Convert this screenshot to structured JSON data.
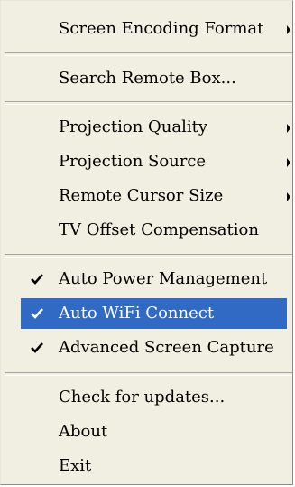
{
  "menu": {
    "items": [
      {
        "label": "Screen Encoding Format",
        "submenu": true
      },
      {
        "label": "Search Remote Box...",
        "submenu": false
      },
      {
        "label": "Projection Quality",
        "submenu": true
      },
      {
        "label": "Projection Source",
        "submenu": true
      },
      {
        "label": "Remote Cursor Size",
        "submenu": true
      },
      {
        "label": "TV Offset Compensation",
        "submenu": false
      },
      {
        "label": "Auto Power Management",
        "checked": true
      },
      {
        "label": "Auto WiFi Connect",
        "checked": true,
        "highlighted": true
      },
      {
        "label": "Advanced Screen Capture",
        "checked": true
      },
      {
        "label": "Check for updates...",
        "submenu": false
      },
      {
        "label": "About",
        "submenu": false
      },
      {
        "label": "Exit",
        "submenu": false
      }
    ]
  },
  "colors": {
    "menu_background": "#f1efe2",
    "highlight_background": "#316ac5",
    "highlight_text": "#ffffff",
    "text": "#000000"
  }
}
